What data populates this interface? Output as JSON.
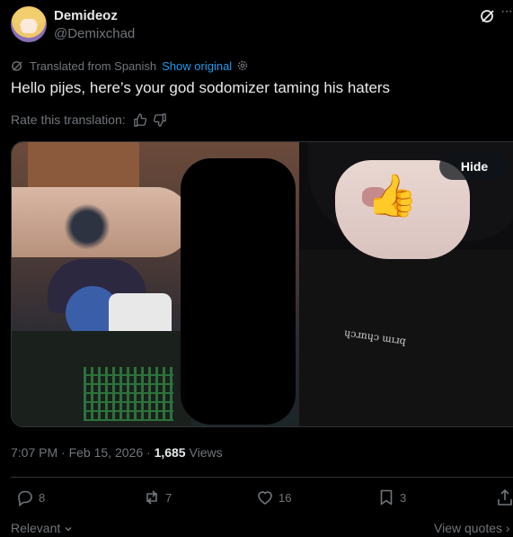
{
  "author": {
    "name": "Demideoz",
    "handle": "@Demixchad"
  },
  "translation": {
    "note": "Translated from Spanish",
    "show_original": "Show original"
  },
  "tweet": {
    "text": "Hello pijes, here’s your god sodomizer taming his haters"
  },
  "rate": {
    "label": "Rate this translation:"
  },
  "media": {
    "hide_label": "Hide",
    "emoji": "👍",
    "shirt_print": "ɥɔɹnɥɔ ɯıɹq"
  },
  "meta": {
    "time": "7:07 PM",
    "date": "Feb 15, 2026",
    "views_count": "1,685",
    "views_label": "Views"
  },
  "actions": {
    "replies": "8",
    "reposts": "7",
    "likes": "16",
    "bookmarks": "3"
  },
  "footer": {
    "sort": "Relevant",
    "view_quotes": "View quotes"
  },
  "colors": {
    "link": "#1d9bf0",
    "muted": "#71767b",
    "text": "#e7e9ea",
    "background": "#000000"
  }
}
